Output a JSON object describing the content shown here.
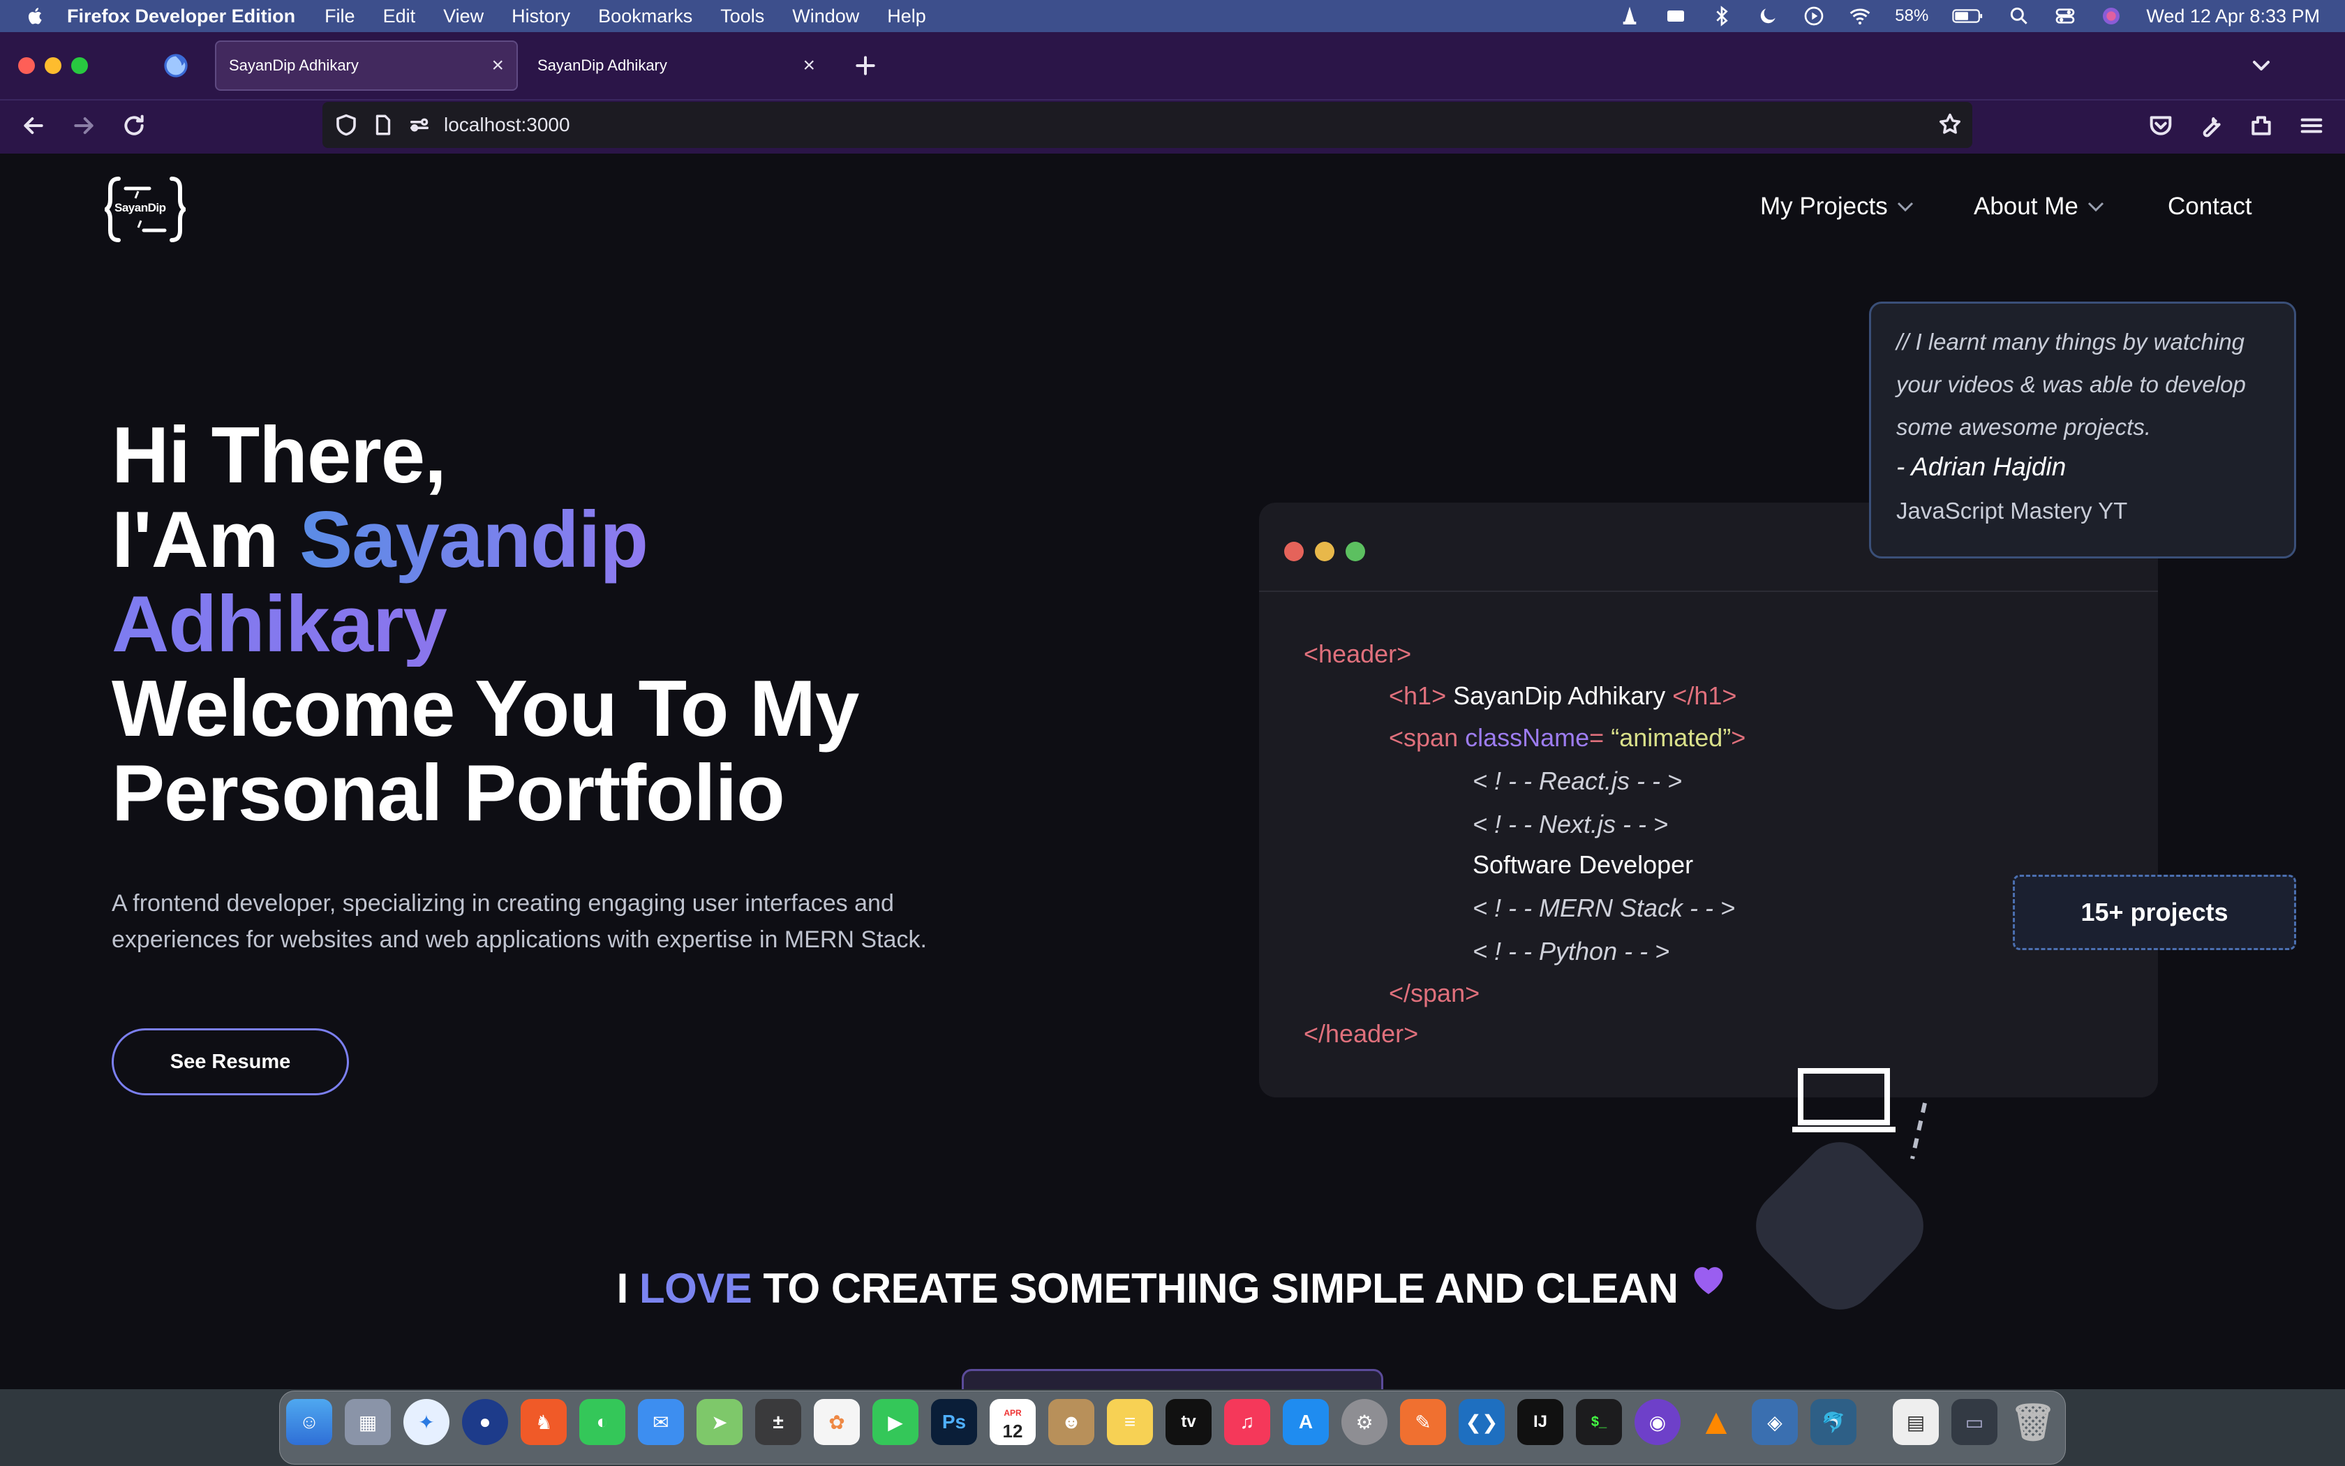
{
  "menubar": {
    "app_name": "Firefox Developer Edition",
    "menus": [
      "File",
      "Edit",
      "View",
      "History",
      "Bookmarks",
      "Tools",
      "Window",
      "Help"
    ],
    "battery": "58%",
    "datetime": "Wed 12 Apr  8:33 PM"
  },
  "browser": {
    "tabs": [
      {
        "title": "SayanDip Adhikary",
        "active": true
      },
      {
        "title": "SayanDip Adhikary",
        "active": false
      }
    ],
    "url": "localhost:3000"
  },
  "site": {
    "logo_text": "SayanDip",
    "nav": {
      "projects": "My Projects",
      "about": "About Me",
      "contact": "Contact"
    },
    "hero": {
      "line1": "Hi There,",
      "line2_prefix": "I'Am",
      "first_name": "Sayandip",
      "last_name": "Adhikary",
      "line4": "Welcome You To My",
      "line5": "Personal Portfolio"
    },
    "description": "A frontend developer, specializing in creating engaging user interfaces and experiences for websites and web applications with expertise in MERN Stack.",
    "resume_button": "See Resume",
    "code": {
      "header_open": "<header>",
      "h1_open": "<h1>",
      "h1_text": "SayanDip Adhikary",
      "h1_close": "</h1>",
      "span_open": "<span",
      "attr": "className",
      "eq": "=",
      "attr_value": "“animated”",
      "span_gt": ">",
      "c1": "< ! - - React.js - - >",
      "c2": "< ! - - Next.js - - >",
      "role": "Software Developer",
      "c3": "< ! - - MERN Stack - - >",
      "c4": "< ! - - Python - - >",
      "span_close": "</span>",
      "header_close": "</header>"
    },
    "testimonial": {
      "text": "// I learnt many things by watching your videos  & was able to develop some awesome projects.",
      "author": "- Adrian Hajdin",
      "source": "JavaScript Mastery YT"
    },
    "badge": "15+ projects",
    "love_line": {
      "pre": "I",
      "love": "LOVE",
      "post": "TO CREATE SOMETHING SIMPLE AND CLEAN"
    }
  },
  "dock": {
    "calendar_month": "APR",
    "calendar_day": "12",
    "apps": [
      "finder",
      "launchpad",
      "safari",
      "firefox",
      "brave",
      "messages",
      "mail",
      "maps",
      "calculator",
      "photos",
      "facetime",
      "photoshop",
      "calendar",
      "contacts",
      "notes",
      "appletv",
      "music",
      "appstore",
      "settings",
      "pen",
      "vscode",
      "intellij",
      "terminal",
      "github",
      "vlc",
      "virtualbox",
      "mysql",
      "document",
      "screenshot",
      "trash"
    ]
  },
  "colors": {
    "menubar": "#3d4f8c",
    "browser_chrome": "#2b1548",
    "page_bg": "#0e0e14",
    "accent_blue": "#5a8ce6",
    "accent_purple": "#9a6de8"
  }
}
